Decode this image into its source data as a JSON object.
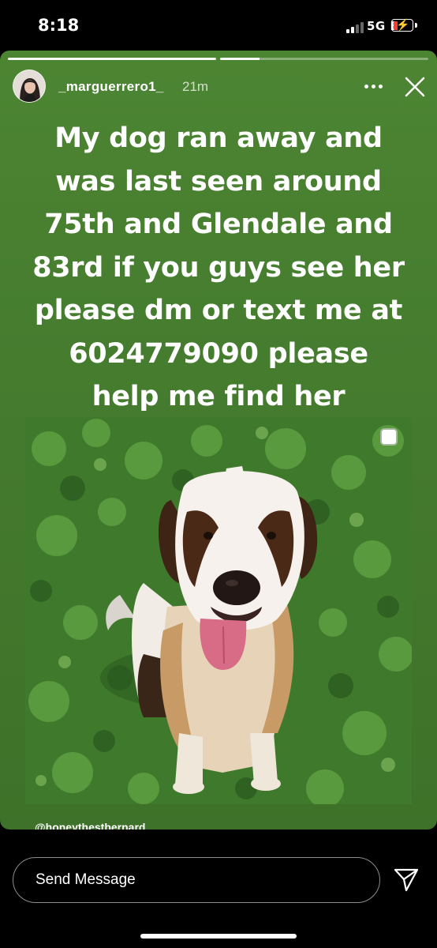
{
  "status_bar": {
    "time": "8:18",
    "network": "5G E",
    "battery_level": 0.15
  },
  "story": {
    "progress_segments": [
      1.0,
      0.19
    ],
    "username": "_marguerrero1_",
    "time_ago": "21m",
    "caption": "My dog ran away and\nwas last seen around\n75th and Glendale and\n83rd if you guys see her\nplease dm or text me at\n6024779090 please\nhelp me find her",
    "photo_credit": "@honeythestbernard",
    "background_color": "#467d2f"
  },
  "composer": {
    "placeholder": "Send Message"
  }
}
